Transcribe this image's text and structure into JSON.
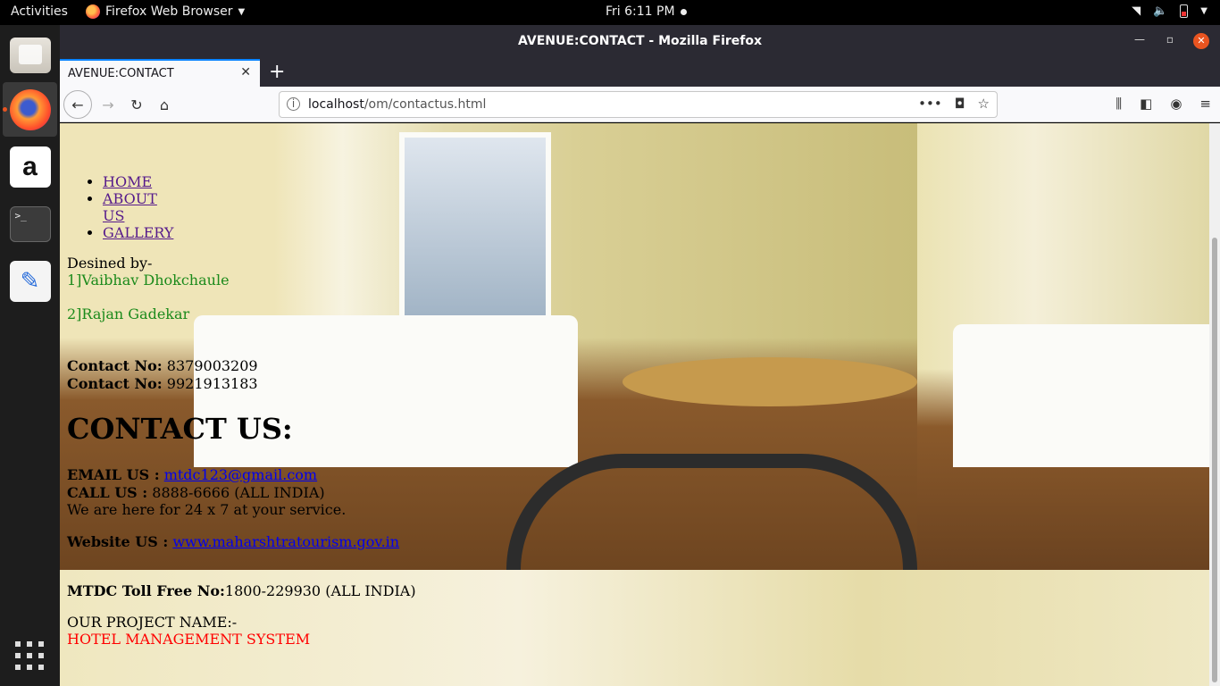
{
  "system": {
    "activities": "Activities",
    "app_name": "Firefox Web Browser",
    "clock": "Fri  6:11 PM"
  },
  "dock": {
    "amazon_glyph": "a",
    "terminal_glyph": ">_"
  },
  "browser": {
    "window_title": "AVENUE:CONTACT - Mozilla Firefox",
    "tab_title": "AVENUE:CONTACT",
    "url_host": "localhost",
    "url_path": "/om/contactus.html"
  },
  "page": {
    "nav": [
      "HOME",
      "ABOUT US",
      "GALLERY"
    ],
    "designed_by_label": "Desined by-",
    "designers": [
      "1]Vaibhav Dhokchaule",
      "2]Rajan Gadekar"
    ],
    "contacts": [
      {
        "label": "Contact No:",
        "value": " 8379003209"
      },
      {
        "label": "Contact No:",
        "value": " 9921913183"
      }
    ],
    "contact_heading": "CONTACT US:",
    "email_label": "EMAIL US :",
    "email": "mtdc123@gmail.com",
    "call_label": "CALL US :",
    "call_value": " 8888-6666 (ALL INDIA)",
    "service_text": "We are here for 24 x 7 at your service.",
    "website_label": "Website US :",
    "website": "www.maharshtratourism.gov.in",
    "tollfree_label": "MTDC Toll Free No:",
    "tollfree_value": "1800-229930 (ALL INDIA)",
    "project_label": "OUR PROJECT NAME:-",
    "project_name": "HOTEL MANAGEMENT SYSTEM"
  },
  "colors": {
    "designer_text": "#1b8a1b",
    "project_text": "#ff0000",
    "dock_bg": "#1d1d1d",
    "browser_chrome": "#2b2a33"
  }
}
